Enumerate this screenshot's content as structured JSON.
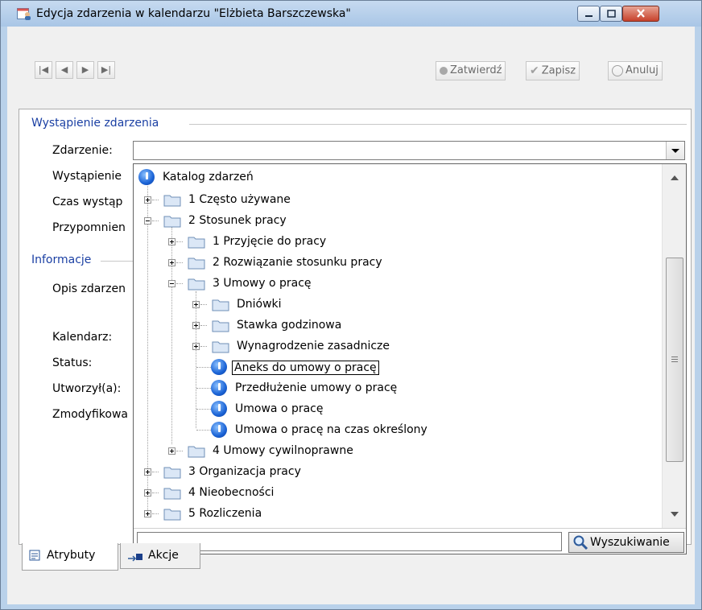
{
  "window": {
    "title": "Edycja zdarzenia w kalendarzu \"Elżbieta Barszczewska\""
  },
  "toolbar": {
    "confirm_label": "Zatwierdź",
    "save_label": "Zapisz",
    "cancel_label": "Anuluj"
  },
  "occurrence": {
    "section_title": "Wystąpienie zdarzenia",
    "event_label": "Zdarzenie:",
    "occurrence_label": "Wystąpienie",
    "time_label": "Czas wystąp",
    "reminder_label": "Przypomnien",
    "event_value": ""
  },
  "info": {
    "section_title": "Informacje",
    "description_label": "Opis zdarzen",
    "calendar_label": "Kalendarz:",
    "status_label": "Status:",
    "created_label": "Utworzył(a):",
    "modified_label": "Zmodyfikowa"
  },
  "tree": {
    "root": "Katalog zdarzeń",
    "n1": "1 Często używane",
    "n2": "2 Stosunek pracy",
    "n2_1": "1 Przyjęcie do pracy",
    "n2_2": "2 Rozwiązanie stosunku pracy",
    "n2_3": "3 Umowy o pracę",
    "n2_3_1": "Dniówki",
    "n2_3_2": "Stawka godzinowa",
    "n2_3_3": "Wynagrodzenie zasadnicze",
    "n2_3_4": "Aneks do umowy o pracę",
    "n2_3_5": "Przedłużenie umowy o pracę",
    "n2_3_6": "Umowa o pracę",
    "n2_3_7": "Umowa o pracę na czas określony",
    "n2_4": "4 Umowy cywilnoprawne",
    "n3": "3 Organizacja pracy",
    "n4": "4 Nieobecności",
    "n5": "5 Rozliczenia"
  },
  "search": {
    "value": "",
    "button_label": "Wyszukiwanie"
  },
  "tabs": {
    "attributes": "Atrybuty",
    "actions": "Akcje"
  },
  "colors": {
    "section_title": "#1a3fa3",
    "info_icon": "#1a63d6",
    "folder": "#dbe7f6"
  }
}
